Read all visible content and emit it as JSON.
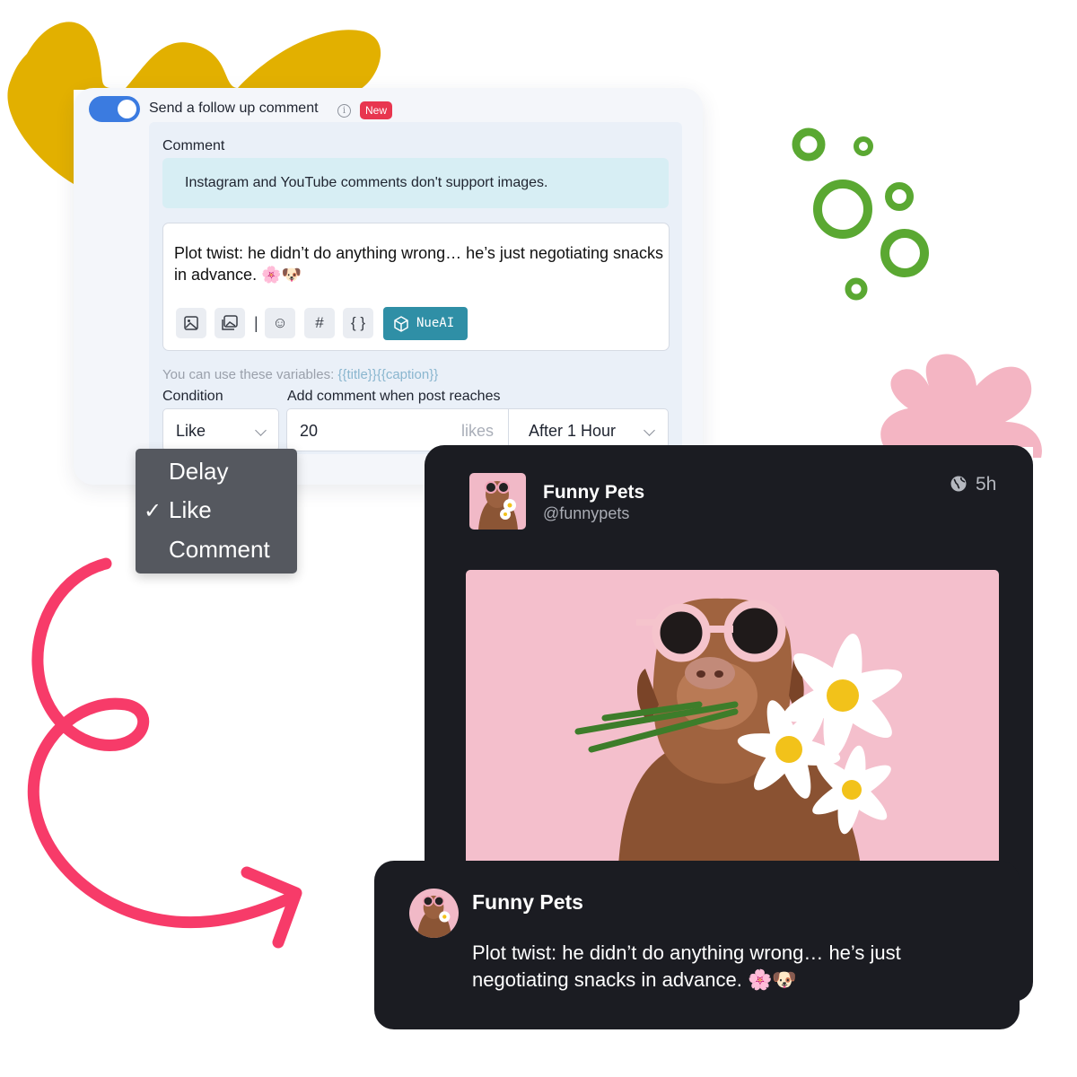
{
  "settings": {
    "toggle_on": true,
    "follow_label": "Send a follow up comment",
    "info_icon_glyph": "i",
    "badge_new": "New",
    "comment_label": "Comment",
    "info_banner": "Instagram and YouTube comments don't support images.",
    "comment_text": "Plot twist: he didn’t do anything wrong… he’s just negotiating snacks in advance. 🌸🐶",
    "toolbar": {
      "separator": "|",
      "buttons": [
        {
          "name": "image-icon"
        },
        {
          "name": "gallery-icon"
        },
        {
          "name": "emoji-icon",
          "glyph": "☺"
        },
        {
          "name": "hashtag-icon",
          "glyph": "#"
        },
        {
          "name": "variables-icon",
          "glyph": "{ }"
        }
      ],
      "ai_button_label": "NueAI",
      "ai_button_color": "#2f8fa6"
    },
    "variables_text": "You can use these variables:",
    "variables": [
      "{{title}}",
      "{{caption}}"
    ],
    "condition_label": "Condition",
    "reach_label": "Add comment when post reaches",
    "condition_value": "Like",
    "reach_value": "20",
    "reach_unit": "likes",
    "timing_value": "After 1 Hour",
    "accent_color": "#3b7be0"
  },
  "dropdown": {
    "options": [
      "Delay",
      "Like",
      "Comment"
    ],
    "selected": "Like",
    "check_glyph": "✓"
  },
  "post": {
    "name": "Funny Pets",
    "handle": "@funnypets",
    "time": "5h",
    "visibility_icon": "globe-icon"
  },
  "comment": {
    "name": "Funny Pets",
    "text": "Plot twist: he didn’t do anything wrong… he’s just negotiating snacks in advance. 🌸🐶"
  }
}
